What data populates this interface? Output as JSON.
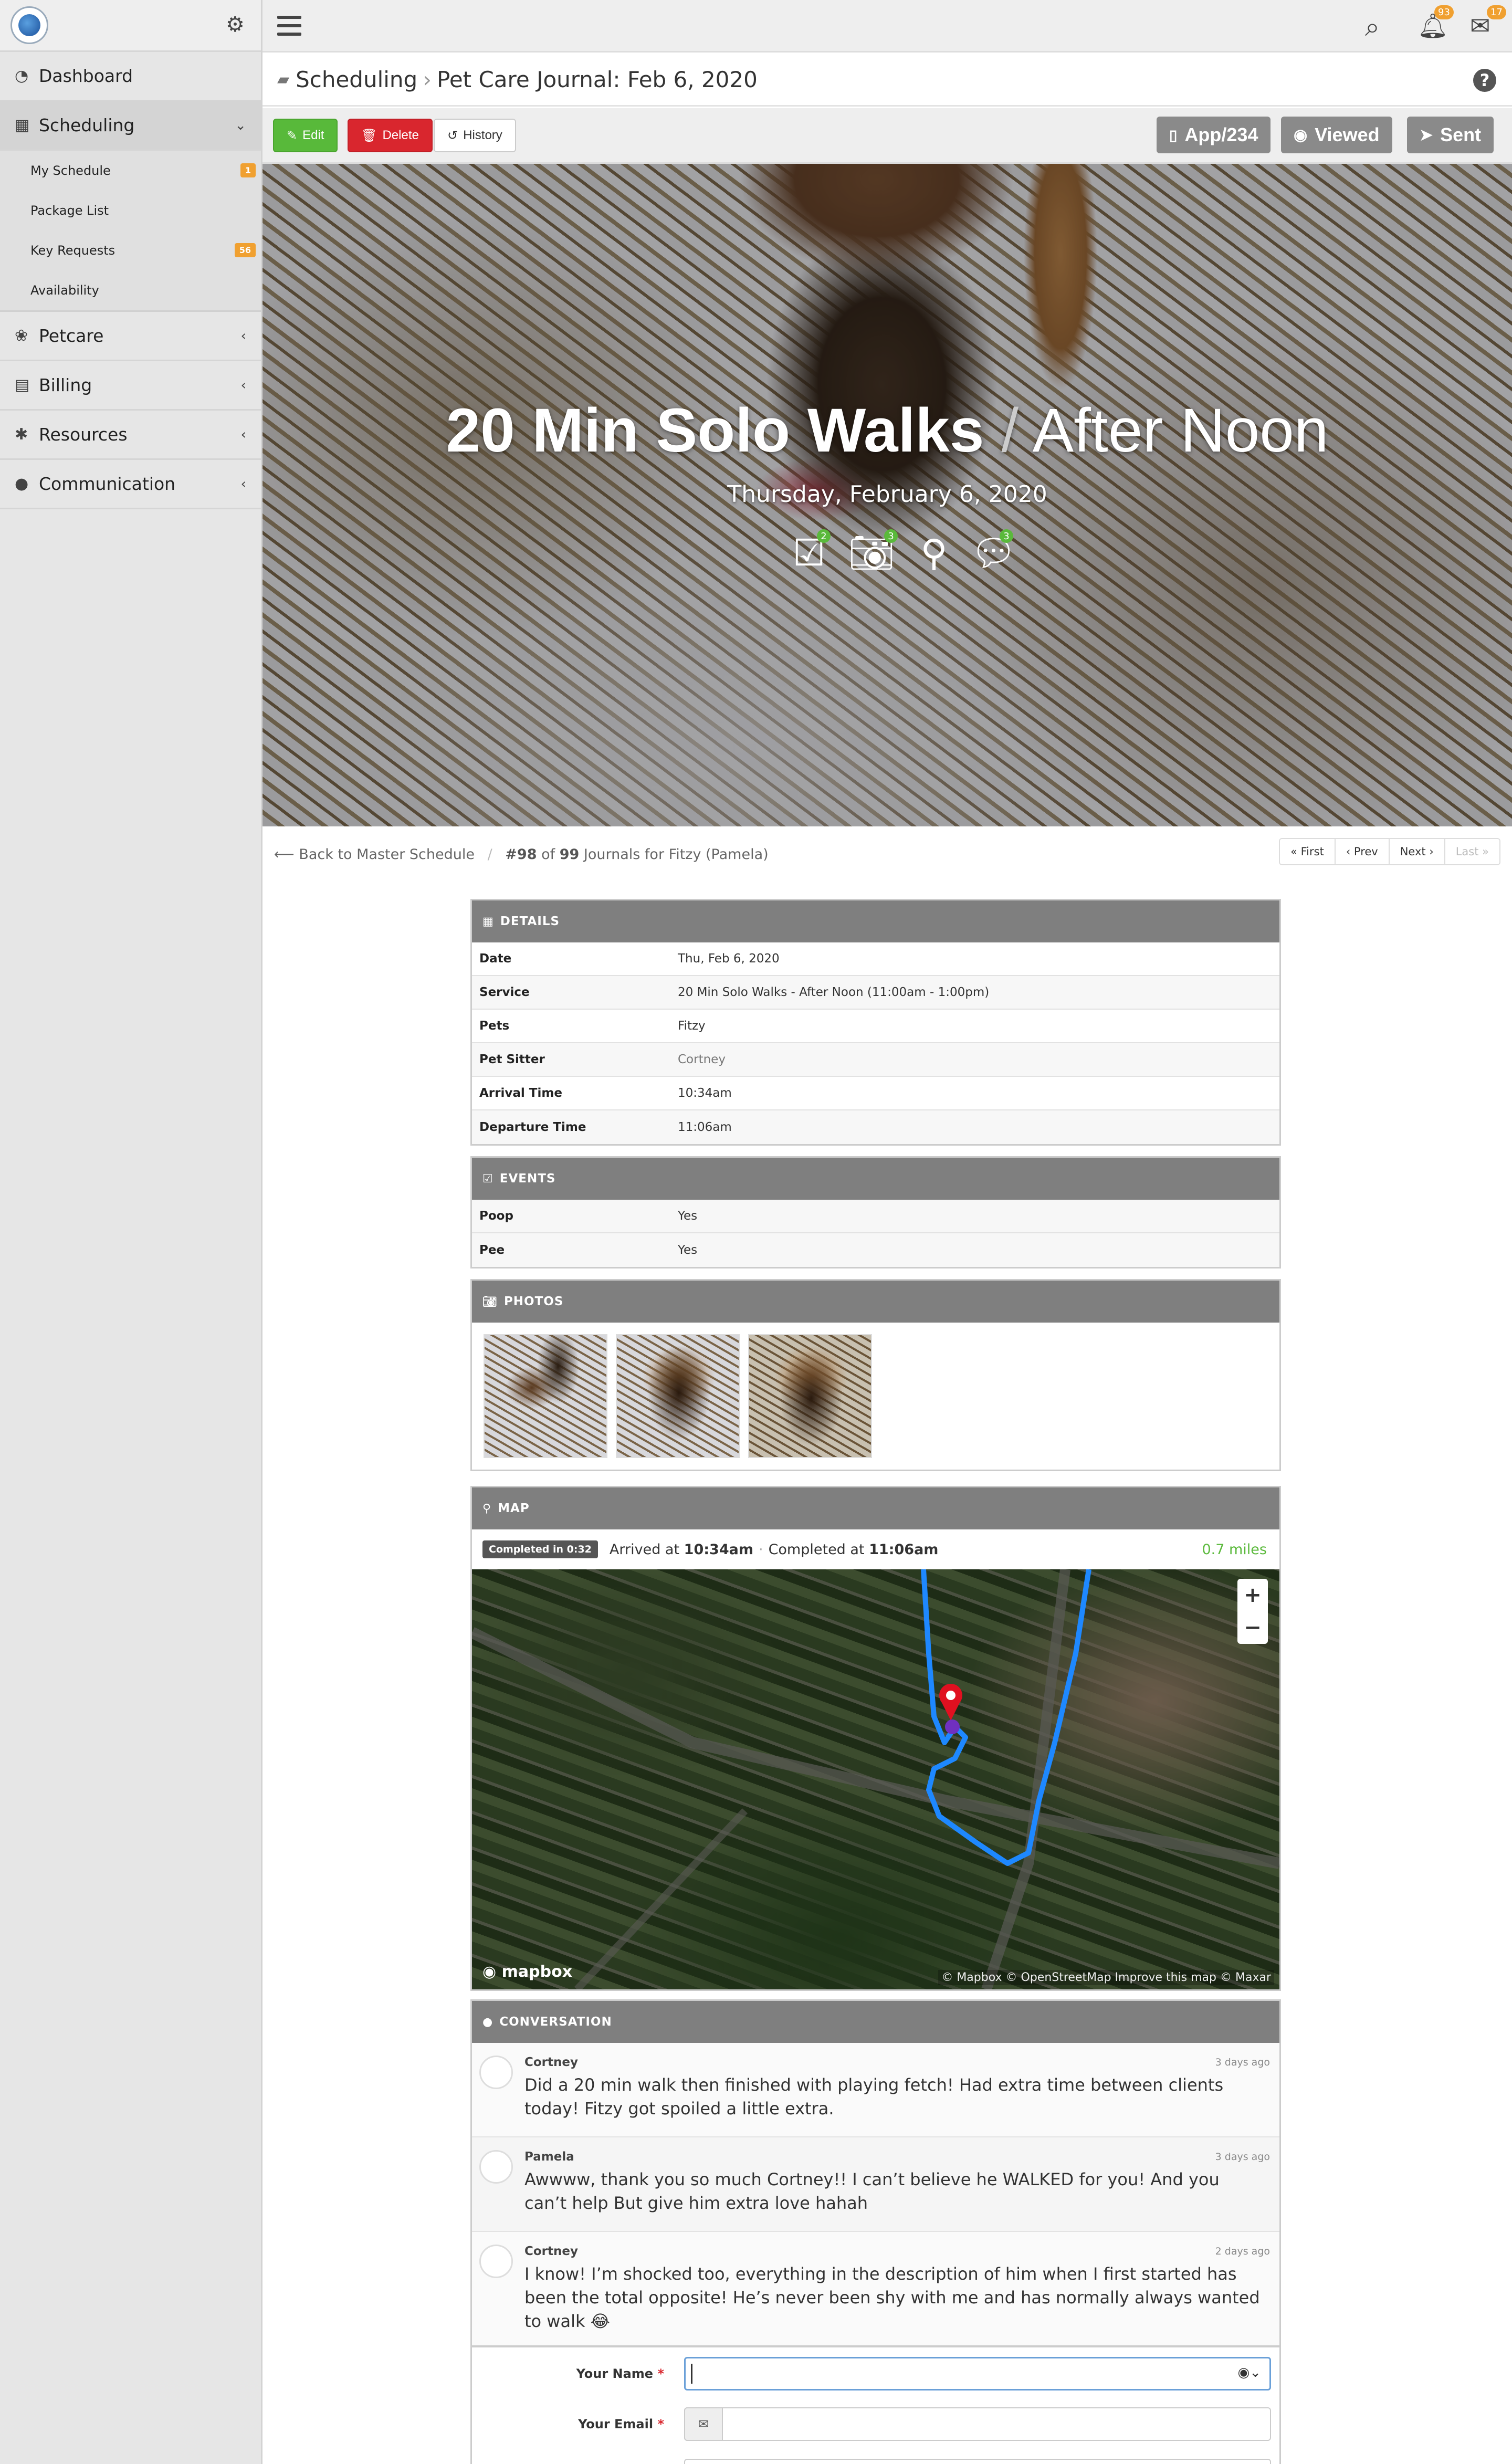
{
  "sidebar": {
    "items": [
      {
        "label": "Dashboard",
        "icon": "dashboard-icon"
      },
      {
        "label": "Scheduling",
        "icon": "calendar-icon"
      },
      {
        "label": "Petcare",
        "icon": "paw-icon"
      },
      {
        "label": "Billing",
        "icon": "invoice-icon"
      },
      {
        "label": "Resources",
        "icon": "asterisk-icon"
      },
      {
        "label": "Communication",
        "icon": "chat-icon"
      }
    ],
    "subitems": [
      {
        "label": "My Schedule",
        "badge": "1"
      },
      {
        "label": "Package List",
        "badge": ""
      },
      {
        "label": "Key Requests",
        "badge": "56"
      },
      {
        "label": "Availability",
        "badge": ""
      }
    ]
  },
  "topbar": {
    "bell_count": "93",
    "mail_count": "17"
  },
  "breadcrumb": {
    "parent": "Scheduling",
    "current": "Pet Care Journal: Feb 6, 2020"
  },
  "actions": {
    "edit": "Edit",
    "delete": "Delete",
    "history": "History",
    "app": "App/234",
    "viewed": "Viewed",
    "sent": "Sent"
  },
  "hero": {
    "title_bold": "20 Min Solo Walks",
    "slash": "/",
    "title_light": "After Noon",
    "date": "Thursday, February 6, 2020",
    "checks": "2",
    "photos": "3",
    "comments": "3"
  },
  "pager": {
    "back": "Back to Master Schedule",
    "pos_prefix": "#98",
    "of": "of",
    "total": "99",
    "suffix": "Journals for Fitzy (Pamela)",
    "first": "« First",
    "prev": "‹ Prev",
    "next": "Next ›",
    "last": "Last »"
  },
  "details": {
    "title": "DETAILS",
    "rows": [
      {
        "k": "Date",
        "v": "Thu, Feb 6, 2020"
      },
      {
        "k": "Service",
        "v": "20 Min Solo Walks - After Noon (11:00am - 1:00pm)"
      },
      {
        "k": "Pets",
        "v": "Fitzy"
      },
      {
        "k": "Pet Sitter",
        "v": "Cortney"
      },
      {
        "k": "Arrival Time",
        "v": "10:34am"
      },
      {
        "k": "Departure Time",
        "v": "11:06am"
      }
    ]
  },
  "events": {
    "title": "EVENTS",
    "rows": [
      {
        "k": "Poop",
        "v": "Yes"
      },
      {
        "k": "Pee",
        "v": "Yes"
      }
    ]
  },
  "photos": {
    "title": "PHOTOS"
  },
  "map": {
    "title": "MAP",
    "completed_tag": "Completed in 0:32",
    "arrived_label": "Arrived at",
    "arrived": "10:34am",
    "completed_label": "Completed at",
    "completed": "11:06am",
    "distance": "0.7 miles",
    "brand": "mapbox",
    "attribution": "© Mapbox © OpenStreetMap Improve this map © Maxar"
  },
  "conversation": {
    "title": "CONVERSATION",
    "messages": [
      {
        "name": "Cortney",
        "time": "3 days ago",
        "text": "Did a 20 min walk then finished with playing fetch! Had extra time between clients today! Fitzy got spoiled a little extra."
      },
      {
        "name": "Pamela",
        "time": "3 days ago",
        "text": "Awwww, thank you so much Cortney!! I can’t believe he WALKED for you! And you can’t help But give him extra love hahah"
      },
      {
        "name": "Cortney",
        "time": "2 days ago",
        "text": "I know! I’m shocked too, everything in the description of him when I first started has been the total opposite! He’s never been shy with me and has normally always wanted to walk 😂"
      }
    ]
  },
  "form": {
    "name_label": "Your Name",
    "email_label": "Your Email",
    "req": "*"
  }
}
